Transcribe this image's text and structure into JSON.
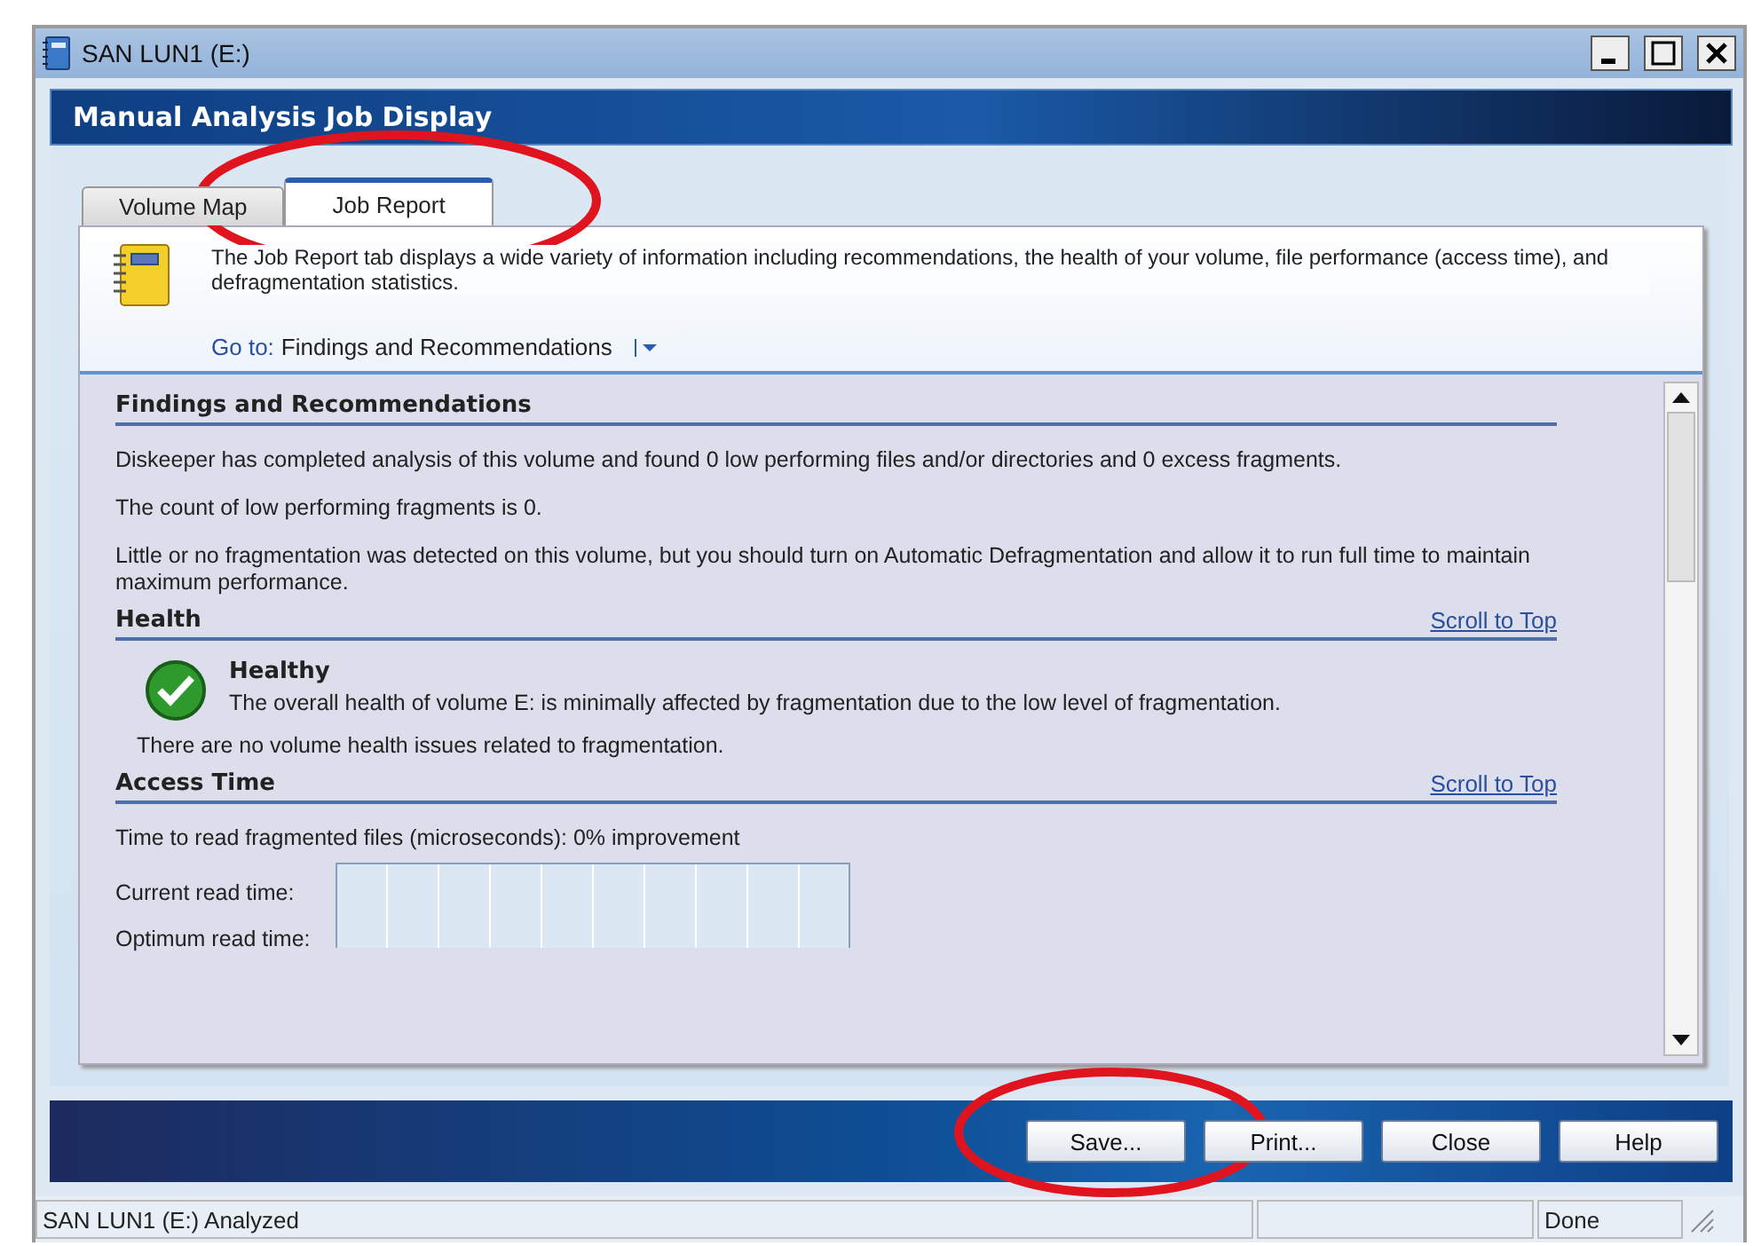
{
  "window": {
    "title": "SAN LUN1 (E:)"
  },
  "header": {
    "title": "Manual Analysis Job Display"
  },
  "tabs": [
    {
      "label": "Volume Map",
      "selected": false
    },
    {
      "label": "Job Report",
      "selected": true
    }
  ],
  "info": {
    "text": "The Job Report tab displays a wide variety of information including recommendations, the health of your volume, file performance (access time), and defragmentation statistics.",
    "goto_label": "Go to:",
    "goto_value": "Findings and Recommendations"
  },
  "sections": [
    {
      "title": "Findings and Recommendations",
      "paragraphs": [
        "Diskeeper has completed analysis of this volume and found 0 low performing files and/or directories and 0 excess fragments.",
        "The count of low performing fragments is 0.",
        "Little or no fragmentation was detected on this volume, but you should turn on Automatic Defragmentation and allow it to run full time to maintain maximum performance."
      ]
    },
    {
      "title": "Health",
      "link": "Scroll to Top",
      "status": {
        "title": "Healthy",
        "text": "The overall health of volume E: is minimally affected by fragmentation due to the low level of fragmentation."
      },
      "paragraphs": [
        "There are no volume health issues related to fragmentation."
      ]
    },
    {
      "title": "Access Time",
      "link": "Scroll to Top",
      "paragraphs": [
        "Time to read fragmented files (microseconds): 0% improvement"
      ],
      "chart_labels": [
        "Current read time:",
        "Optimum read time:"
      ]
    }
  ],
  "buttons": [
    "Save...",
    "Print...",
    "Close",
    "Help"
  ],
  "status_bar": {
    "left": "SAN LUN1 (E:) Analyzed",
    "right": "Done"
  }
}
